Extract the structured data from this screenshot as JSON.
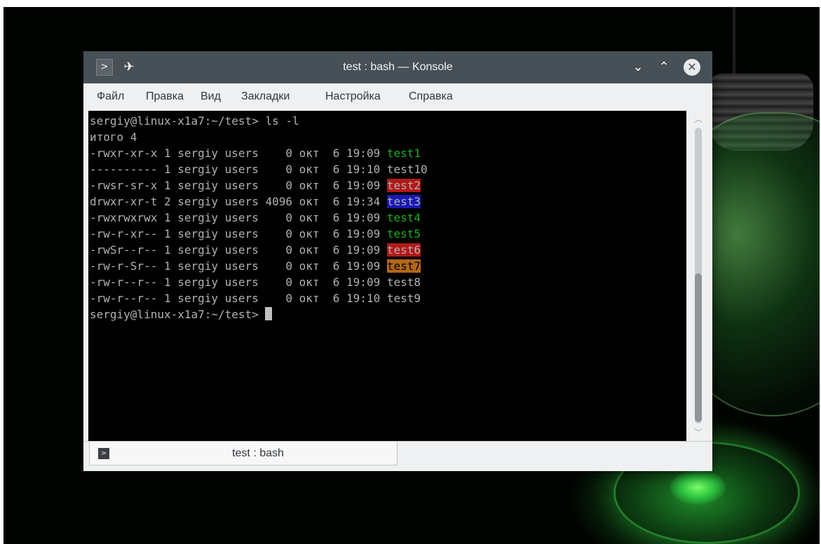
{
  "window": {
    "title": "test : bash — Konsole",
    "icons": {
      "app": "terminal-icon",
      "pin": "pin-icon",
      "minimize": "chevron-down-icon",
      "maximize": "chevron-up-icon",
      "close": "close-icon"
    }
  },
  "menubar": {
    "items": [
      "Файл",
      "Правка",
      "Вид",
      "Закладки",
      "Настройка",
      "Справка"
    ]
  },
  "terminal": {
    "prompt": "sergiy@linux-x1a7:~/test>",
    "command": " ls -l",
    "total": "итого 4",
    "rows": [
      {
        "perm": "-rwxr-xr-x 1 sergiy users    0 окт  6 19:09 ",
        "name": "test1",
        "style": "g"
      },
      {
        "perm": "---------- 1 sergiy users    0 окт  6 19:10 ",
        "name": "test10",
        "style": "w"
      },
      {
        "perm": "-rwsr-sr-x 1 sergiy users    0 окт  6 19:09 ",
        "name": "test2",
        "style": "red"
      },
      {
        "perm": "drwxr-xr-t 2 sergiy users 4096 окт  6 19:34 ",
        "name": "test3",
        "style": "blue"
      },
      {
        "perm": "-rwxrwxrwx 1 sergiy users    0 окт  6 19:09 ",
        "name": "test4",
        "style": "g"
      },
      {
        "perm": "-rw-r-xr-- 1 sergiy users    0 окт  6 19:09 ",
        "name": "test5",
        "style": "g"
      },
      {
        "perm": "-rwSr--r-- 1 sergiy users    0 окт  6 19:09 ",
        "name": "test6",
        "style": "red"
      },
      {
        "perm": "-rw-r-Sr-- 1 sergiy users    0 окт  6 19:09 ",
        "name": "test7",
        "style": "orange"
      },
      {
        "perm": "-rw-r--r-- 1 sergiy users    0 окт  6 19:09 ",
        "name": "test8",
        "style": "w"
      },
      {
        "perm": "-rw-r--r-- 1 sergiy users    0 окт  6 19:10 ",
        "name": "test9",
        "style": "w"
      }
    ],
    "colors": {
      "executable": "#18b218",
      "setuid_bg": "#b21818",
      "sticky_dir_bg": "#1818b2",
      "setgid_bg": "#b26818",
      "foreground": "#b2b2b2",
      "background": "#000000"
    }
  },
  "tab": {
    "label": "test : bash",
    "icon": "terminal-icon"
  }
}
